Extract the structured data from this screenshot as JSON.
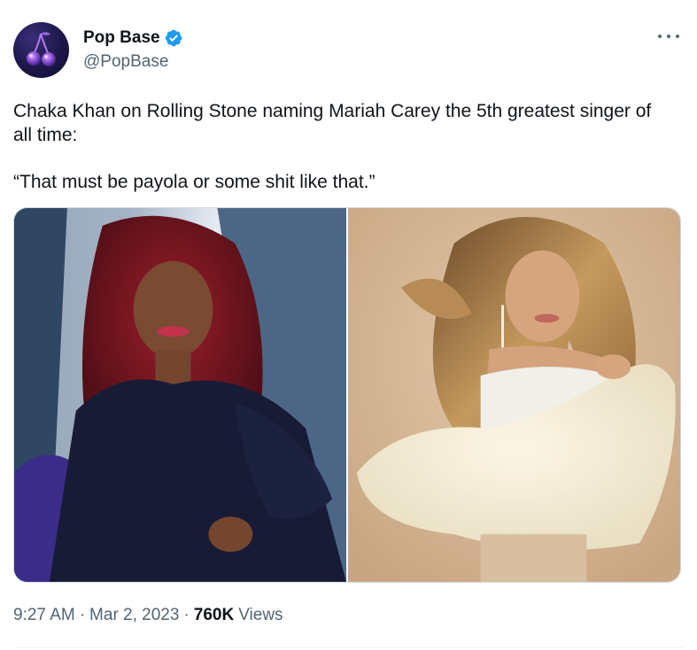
{
  "author": {
    "display_name": "Pop Base",
    "handle": "@PopBase",
    "verified": true,
    "avatar_icon": "cherry-icon",
    "avatar_color": "#1c1748"
  },
  "tweet": {
    "text_line1": "Chaka Khan on Rolling Stone naming Mariah Carey the 5th greatest singer of all time:",
    "text_line2": "“That must be payola or some shit like that.”"
  },
  "media": {
    "images": [
      {
        "icon": "chaka-khan-photo"
      },
      {
        "icon": "mariah-carey-photo"
      }
    ]
  },
  "meta": {
    "time": "9:27 AM",
    "separator1": "·",
    "date": "Mar 2, 2023",
    "separator2": "·",
    "views_count": "760K",
    "views_label": "Views"
  },
  "colors": {
    "verified_badge": "#1d9bf0",
    "secondary_text": "#536471",
    "primary_text": "#0f1419",
    "border": "#cfd9de"
  }
}
